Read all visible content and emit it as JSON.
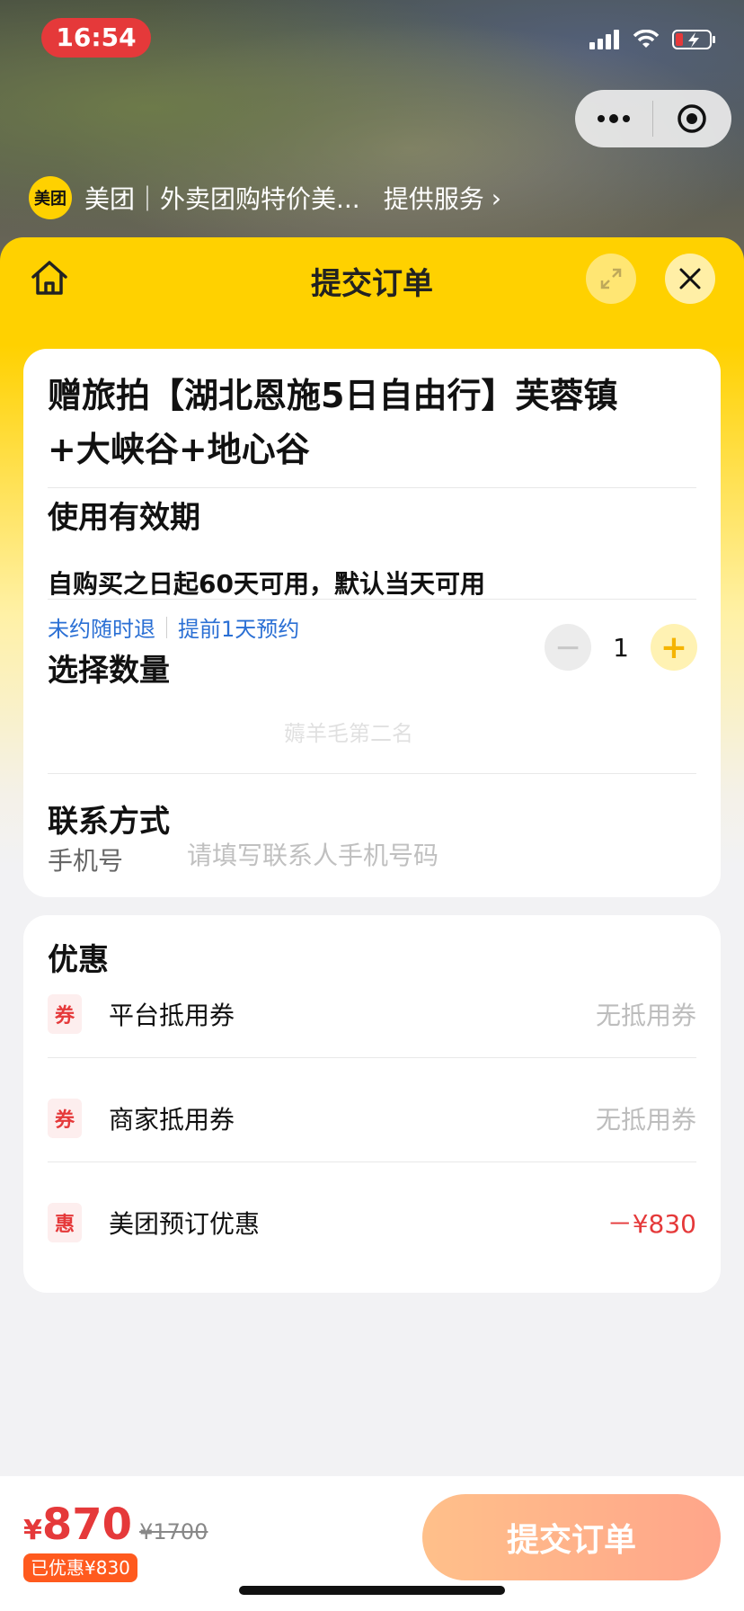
{
  "status_bar": {
    "time": "16:54"
  },
  "provider": {
    "logo_text": "美团",
    "name": "美团｜外卖团购特价美...",
    "service": "提供服务",
    "chevron": "›"
  },
  "sheet": {
    "title": "提交订单"
  },
  "product": {
    "title": "赠旅拍【湖北恩施5日自由行】芙蓉镇+大峡谷+地心谷"
  },
  "validity": {
    "label": "使用有效期",
    "text": "自购买之日起60天可用，默认当天可用",
    "tags": [
      "未约随时退",
      "提前1天预约"
    ]
  },
  "quantity": {
    "label": "选择数量",
    "value": "1",
    "minus": "−",
    "plus": "+"
  },
  "contact": {
    "label": "联系方式",
    "phone_label": "手机号",
    "phone_placeholder": "请填写联系人手机号码"
  },
  "watermark": "薅羊毛第二名",
  "discounts": {
    "title": "优惠",
    "items": [
      {
        "badge": "券",
        "name": "平台抵用券",
        "value": "无抵用券"
      },
      {
        "badge": "券",
        "name": "商家抵用券",
        "value": "无抵用券"
      },
      {
        "badge": "惠",
        "name": "美团预订优惠",
        "value": "－¥830"
      }
    ]
  },
  "bottom": {
    "currency": "¥",
    "price": "870",
    "original_price": "¥1700",
    "saved": "已优惠¥830",
    "submit_label": "提交订单"
  },
  "colors": {
    "brand_yellow": "#ffd100",
    "price_red": "#e5393a",
    "link_blue": "#2a6fd4"
  }
}
